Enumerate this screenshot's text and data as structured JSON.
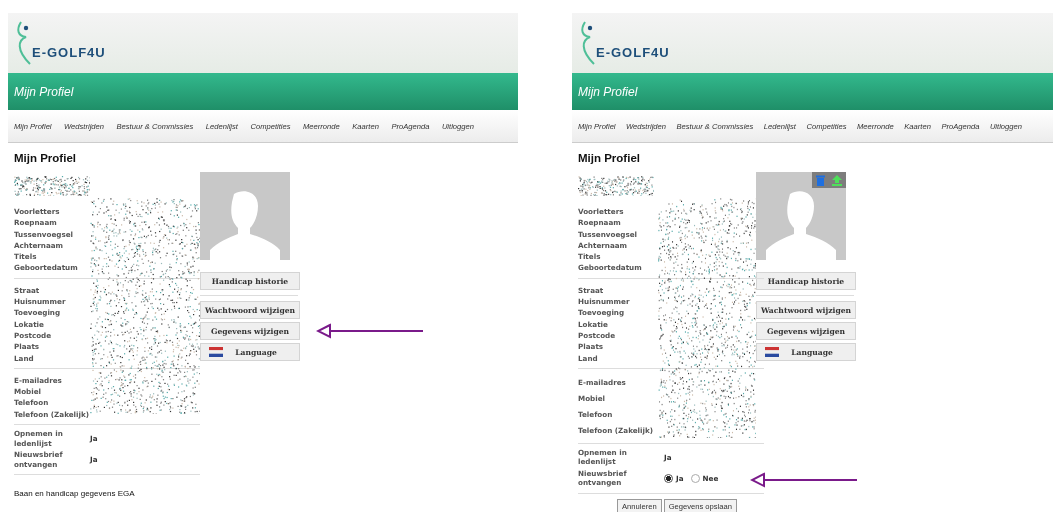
{
  "panels": [
    {
      "logo": "E-GOLF4U",
      "banner": "Mijn Profiel",
      "nav": [
        "Mijn Profiel",
        "Wedstrijden",
        "Bestuur & Commissies",
        "Ledenlijst",
        "Competities",
        "Meerronde",
        "Kaarten",
        "ProAgenda",
        "Uitloggen"
      ],
      "heading": "Mijn Profiel",
      "editing": false,
      "photo_actions": false,
      "field_groups": [
        [
          "Voorletters",
          "Roepnaam",
          "Tussenvoegsel",
          "Achternaam",
          "Titels",
          "Geboortedatum"
        ],
        [
          "Straat",
          "Huisnummer",
          "Toevoeging",
          "Lokatie",
          "Postcode",
          "Plaats",
          "Land"
        ],
        [
          "E-mailadres",
          "Mobiel",
          "Telefoon",
          "Telefoon (Zakelijk)"
        ]
      ],
      "preferences": [
        {
          "label": "Opnemen in ledenlijst",
          "kind": "text",
          "value": "Ja",
          "arrow": false
        },
        {
          "label": "Nieuwsbrief ontvangen",
          "kind": "text",
          "value": "Ja",
          "arrow": false
        }
      ],
      "button_groups": [
        [
          {
            "label": "Handicap historie",
            "kind": "plain",
            "arrow": false
          }
        ],
        [
          {
            "label": "Wachtwoord wijzigen",
            "kind": "plain",
            "arrow": false
          },
          {
            "label": "Gegevens wijzigen",
            "kind": "plain",
            "arrow": true
          },
          {
            "label": "Language",
            "kind": "flag",
            "arrow": false
          }
        ]
      ],
      "footer": "Baan en handicap gegevens EGA"
    },
    {
      "logo": "E-GOLF4U",
      "banner": "Mijn Profiel",
      "nav": [
        "Mijn Profiel",
        "Wedstrijden",
        "Bestuur & Commissies",
        "Ledenlijst",
        "Competities",
        "Meerronde",
        "Kaarten",
        "ProAgenda",
        "Uitloggen"
      ],
      "heading": "Mijn Profiel",
      "editing": true,
      "photo_actions": true,
      "field_groups": [
        [
          "Voorletters",
          "Roepnaam",
          "Tussenvoegsel",
          "Achternaam",
          "Titels",
          "Geboortedatum"
        ],
        [
          "Straat",
          "Huisnummer",
          "Toevoeging",
          "Lokatie",
          "Postcode",
          "Plaats",
          "Land"
        ],
        [
          "E-mailadres",
          "Mobiel",
          "Telefoon",
          "Telefoon (Zakelijk)"
        ]
      ],
      "preferences": [
        {
          "label": "Opnemen in ledenlijst",
          "kind": "text",
          "value": "Ja",
          "arrow": false
        },
        {
          "label": "Nieuwsbrief ontvangen",
          "kind": "radio",
          "options": [
            {
              "label": "Ja",
              "selected": true
            },
            {
              "label": "Nee",
              "selected": false
            }
          ],
          "arrow": true
        }
      ],
      "button_groups": [
        [
          {
            "label": "Handicap historie",
            "kind": "plain",
            "arrow": false
          }
        ],
        [
          {
            "label": "Wachtwoord wijzigen",
            "kind": "plain",
            "arrow": false
          },
          {
            "label": "Gegevens wijzigen",
            "kind": "plain",
            "arrow": false
          },
          {
            "label": "Language",
            "kind": "flag",
            "arrow": false
          }
        ]
      ],
      "form_buttons": [
        "Annuleren",
        "Gegevens opslaan"
      ]
    }
  ]
}
